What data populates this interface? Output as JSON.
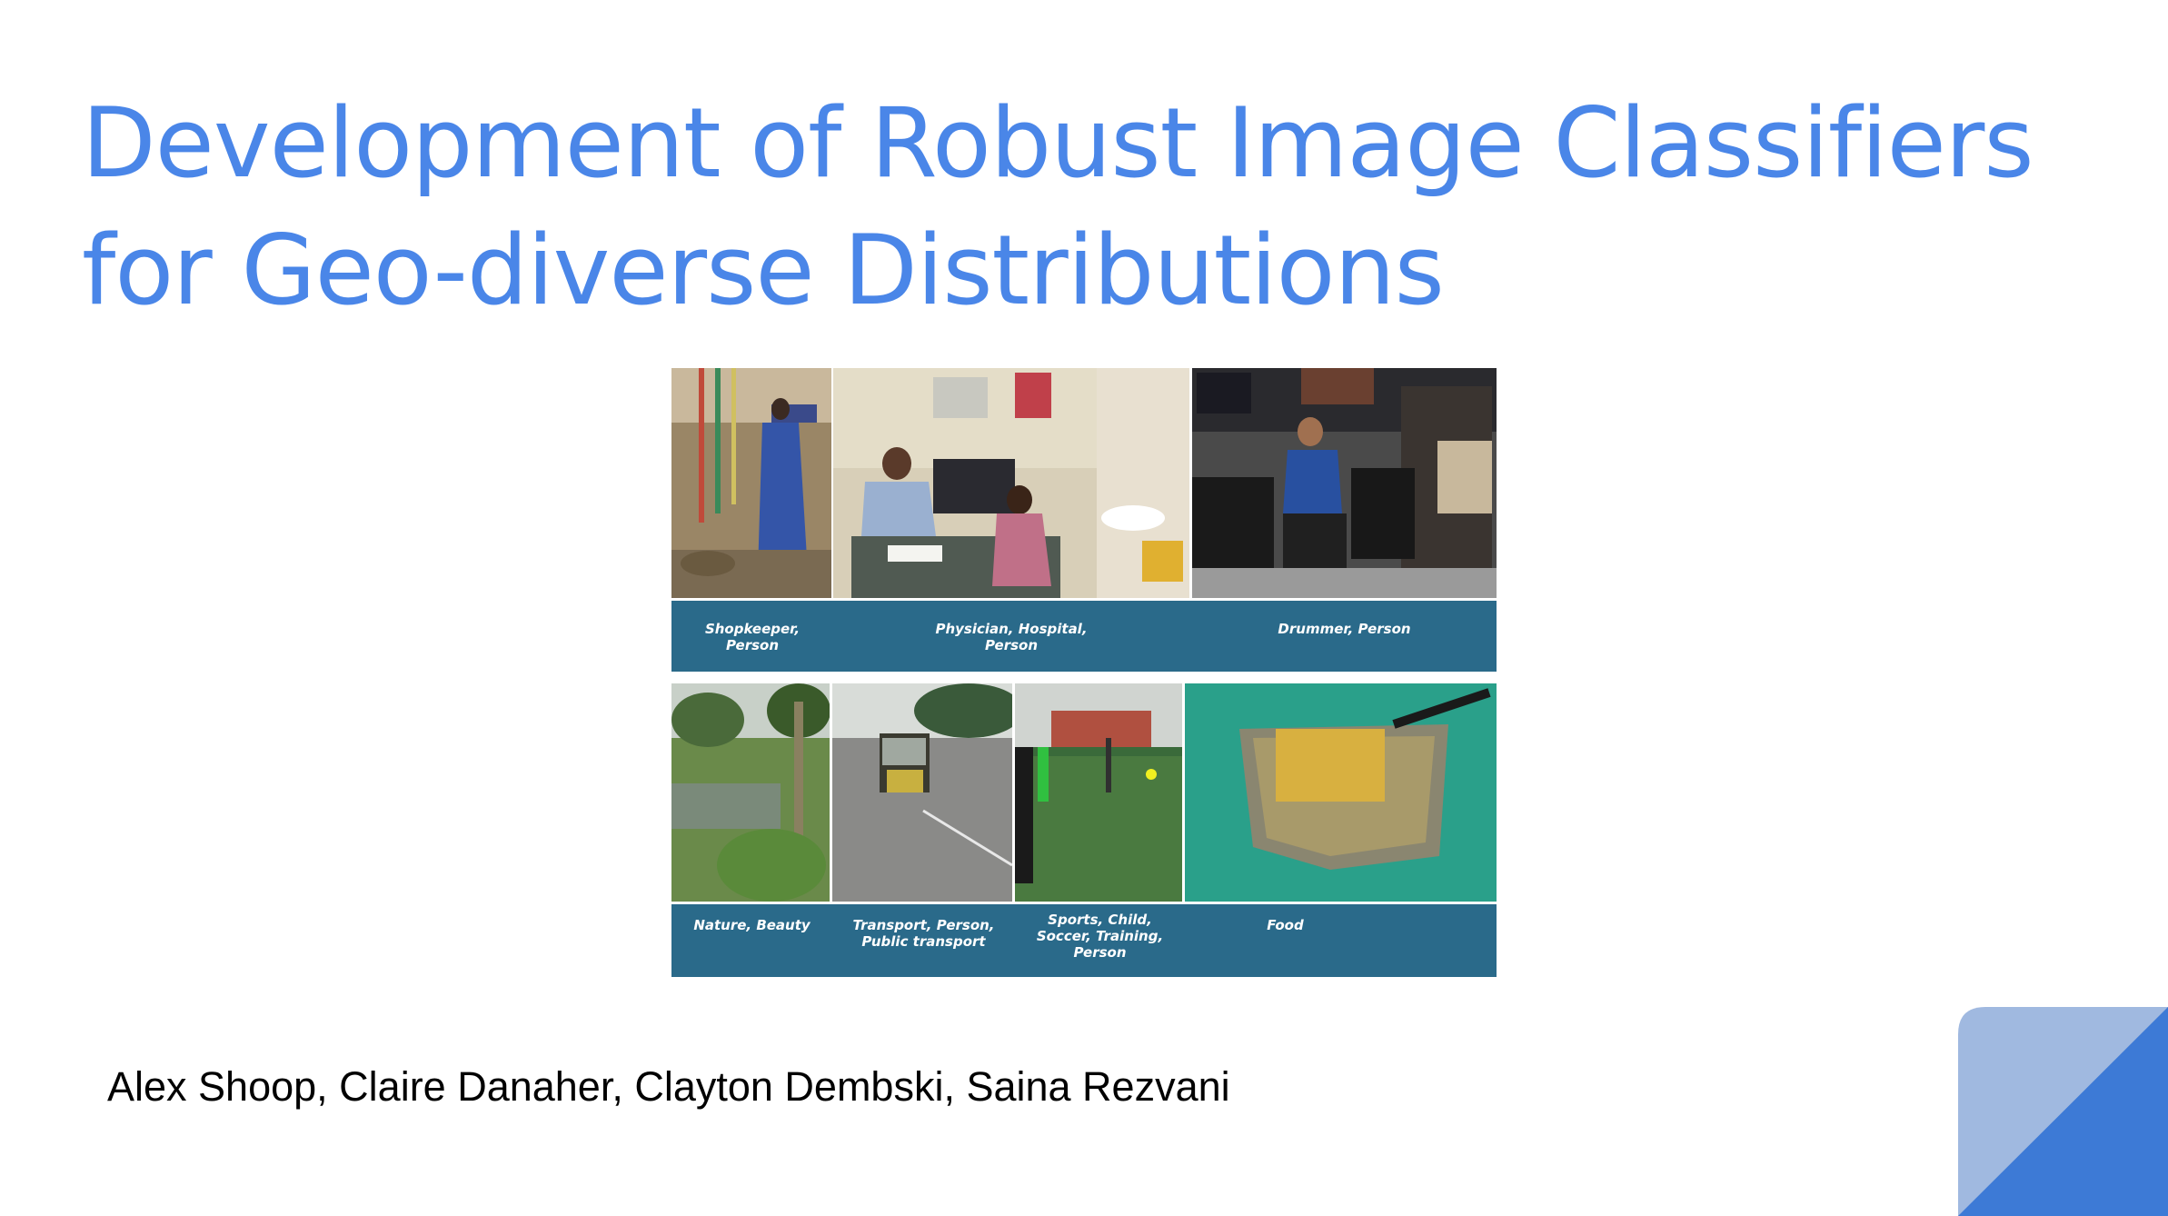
{
  "slide": {
    "title_line1": "Development of Robust Image Classifiers",
    "title_line2": "for Geo-diverse Distributions",
    "authors": "Alex Shoop, Claire Danaher, Clayton Dembski, Saina Rezvani"
  },
  "figure": {
    "top_captions": [
      "Shopkeeper,\nPerson",
      "Physician, Hospital,\nPerson",
      "Drummer, Person"
    ],
    "bottom_captions": [
      "Nature, Beauty",
      "Transport, Person,\nPublic transport",
      "Sports, Child,\nSoccer, Training,\nPerson",
      "Food"
    ],
    "caption_bar_color": "#2a6a8a"
  },
  "theme": {
    "title_color": "#4a86e8",
    "corner_light": "#a0b9e0",
    "corner_dark": "#3d7ad6"
  }
}
